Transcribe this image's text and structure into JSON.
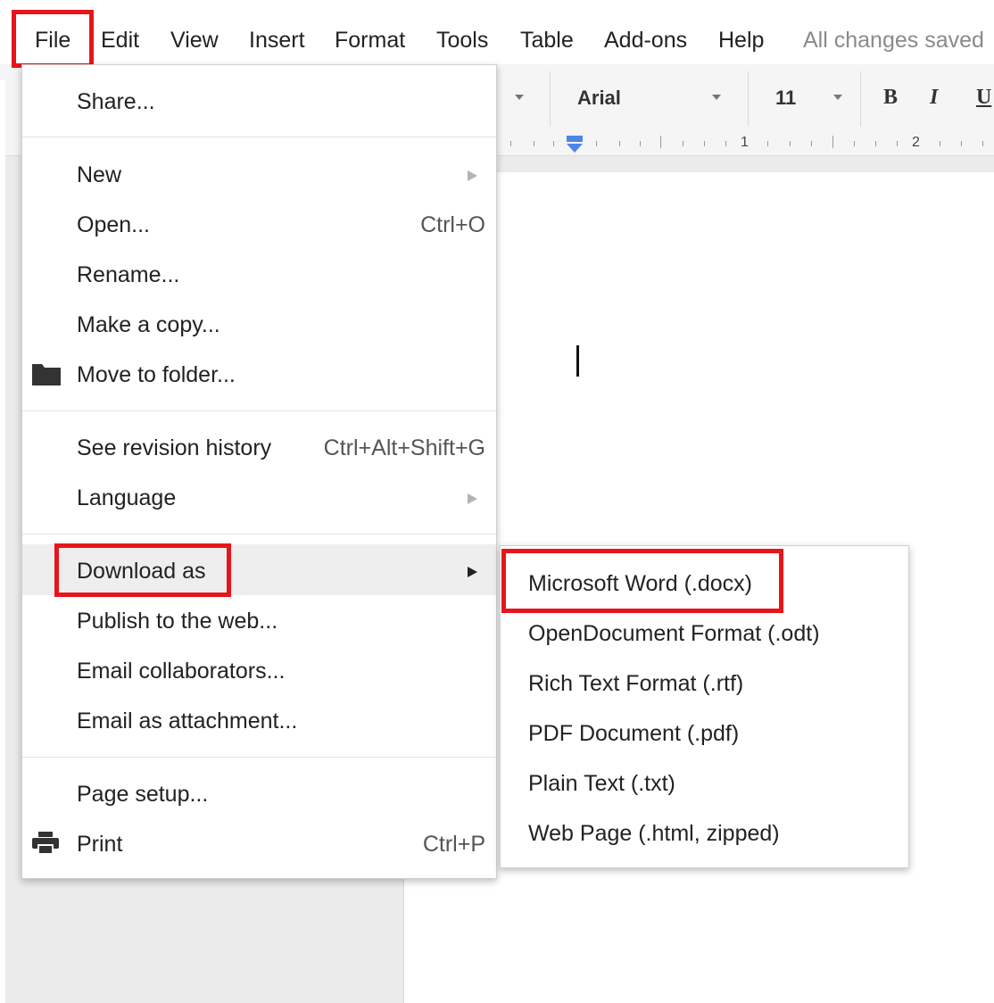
{
  "menubar": {
    "items": [
      "File",
      "Edit",
      "View",
      "Insert",
      "Format",
      "Tools",
      "Table",
      "Add-ons",
      "Help"
    ],
    "status": "All changes saved"
  },
  "toolbar": {
    "font_name": "Arial",
    "font_size": "11",
    "bold_label": "B",
    "italic_label": "I",
    "underline_label": "U"
  },
  "ruler": {
    "numbers": [
      "1",
      "2"
    ]
  },
  "file_menu": {
    "share": "Share...",
    "new": "New",
    "open": "Open...",
    "open_shortcut": "Ctrl+O",
    "rename": "Rename...",
    "make_copy": "Make a copy...",
    "move_to_folder": "Move to folder...",
    "revision_history": "See revision history",
    "revision_history_shortcut": "Ctrl+Alt+Shift+G",
    "language": "Language",
    "download_as": "Download as",
    "publish": "Publish to the web...",
    "email_collaborators": "Email collaborators...",
    "email_attachment": "Email as attachment...",
    "page_setup": "Page setup...",
    "print": "Print",
    "print_shortcut": "Ctrl+P"
  },
  "download_submenu": {
    "items": [
      "Microsoft Word (.docx)",
      "OpenDocument Format (.odt)",
      "Rich Text Format (.rtf)",
      "PDF Document (.pdf)",
      "Plain Text (.txt)",
      "Web Page (.html, zipped)"
    ]
  },
  "colors": {
    "highlight_box": "#e8141b",
    "menu_hover": "#eeeeee",
    "status_text": "#8a8a8a"
  },
  "icons": {
    "folder": "folder-icon",
    "print": "printer-icon",
    "submenu_arrow": "chevron-right-icon"
  }
}
